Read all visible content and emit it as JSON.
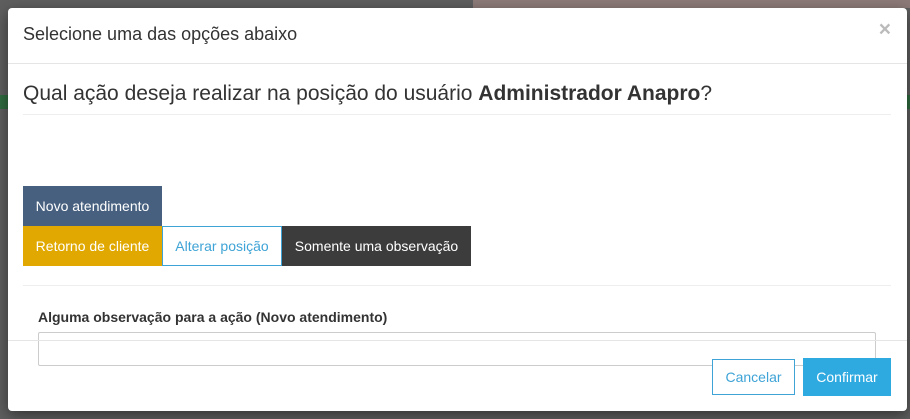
{
  "modal": {
    "title": "Selecione uma das opções abaixo",
    "close_glyph": "×"
  },
  "question": {
    "prefix": "Qual ação deseja realizar na posição do usuário ",
    "user": "Administrador Anapro",
    "suffix": "?"
  },
  "actions": {
    "novo": "Novo atendimento",
    "retorno": "Retorno de cliente",
    "alterar": "Alterar posição",
    "observacao": "Somente uma observação"
  },
  "observation": {
    "label": "Alguma observação para a ação (Novo atendimento)",
    "value": "",
    "placeholder": ""
  },
  "footer": {
    "cancel": "Cancelar",
    "confirm": "Confirmar"
  },
  "colors": {
    "primary": "#47607f",
    "warning": "#e0a800",
    "info": "#3ea3d6",
    "dark": "#3c3c3c",
    "confirm": "#2eaae1"
  }
}
